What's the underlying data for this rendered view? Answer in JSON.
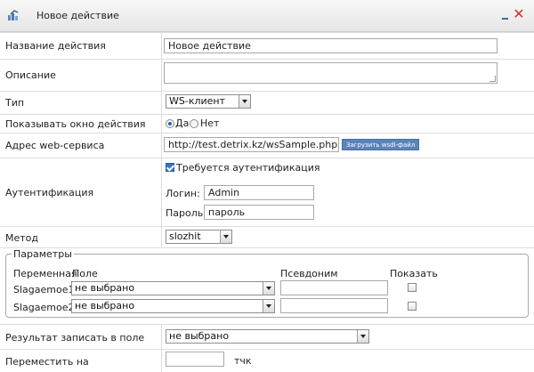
{
  "dialog": {
    "title": "Новое действие",
    "accent_color": "#3a6fa9",
    "close_color": "#d83232"
  },
  "fields": {
    "name": {
      "label": "Название действия",
      "value": "Новое действие"
    },
    "description": {
      "label": "Описание",
      "value": ""
    },
    "type": {
      "label": "Тип",
      "value": "WS-клиент"
    },
    "show_window": {
      "label": "Показывать окно действия",
      "yes": "Да",
      "no": "Нет",
      "selected": "Да"
    },
    "service_url": {
      "label": "Адрес web-сервиса",
      "value": "http://test.detrix.kz/wsSample.php?wsdl",
      "load_button": "Загрузить wsdl-файл"
    },
    "auth": {
      "label": "Аутентификация",
      "required_label": "Требуется аутентификация",
      "required": true,
      "login_label": "Логин:",
      "login_value": "Admin",
      "password_label": "Пароль:",
      "password_value": "пароль"
    },
    "method": {
      "label": "Метод",
      "value": "slozhit"
    }
  },
  "params": {
    "legend": "Параметры",
    "headers": {
      "variable": "Переменная",
      "field": "Поле",
      "alias": "Псевдоним",
      "show": "Показать"
    },
    "rows": [
      {
        "name": "Slagaemoe1",
        "field": "не выбрано",
        "alias": "",
        "show": false
      },
      {
        "name": "Slagaemoe2",
        "field": "не выбрано",
        "alias": "",
        "show": false
      }
    ]
  },
  "result": {
    "label": "Результат записать в поле",
    "value": "не выбрано"
  },
  "move": {
    "label": "Переместить на",
    "value": "",
    "unit": "тчк"
  }
}
